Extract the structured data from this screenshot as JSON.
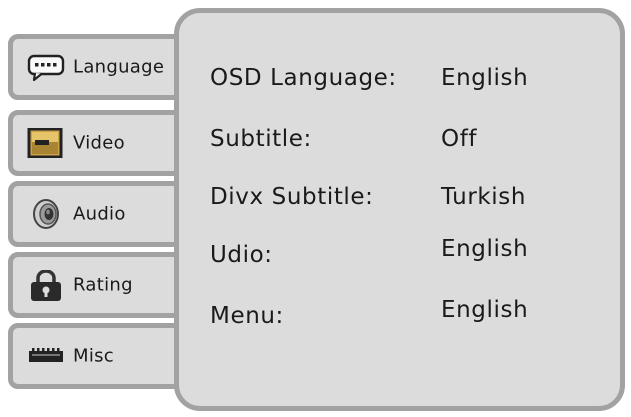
{
  "menu": {
    "tabs": [
      {
        "label": "Language",
        "icon": "speech-bubble-icon",
        "selected": true
      },
      {
        "label": "Video",
        "icon": "video-screen-icon",
        "selected": false
      },
      {
        "label": "Audio",
        "icon": "speaker-icon",
        "selected": false
      },
      {
        "label": "Rating",
        "icon": "lock-icon",
        "selected": false
      },
      {
        "label": "Misc",
        "icon": "connector-icon",
        "selected": false
      }
    ]
  },
  "settings": [
    {
      "label": "OSD Language:",
      "value": "English"
    },
    {
      "label": "Subtitle:",
      "value": "Off"
    },
    {
      "label": "Divx Subtitle:",
      "value": "Turkish"
    },
    {
      "label": "Udio:",
      "value": "English"
    },
    {
      "label": "Menu:",
      "value": "English"
    }
  ],
  "colors": {
    "panel_fill": "#dcdcdc",
    "panel_border": "#a2a2a2",
    "text": "#1a1a1a"
  }
}
